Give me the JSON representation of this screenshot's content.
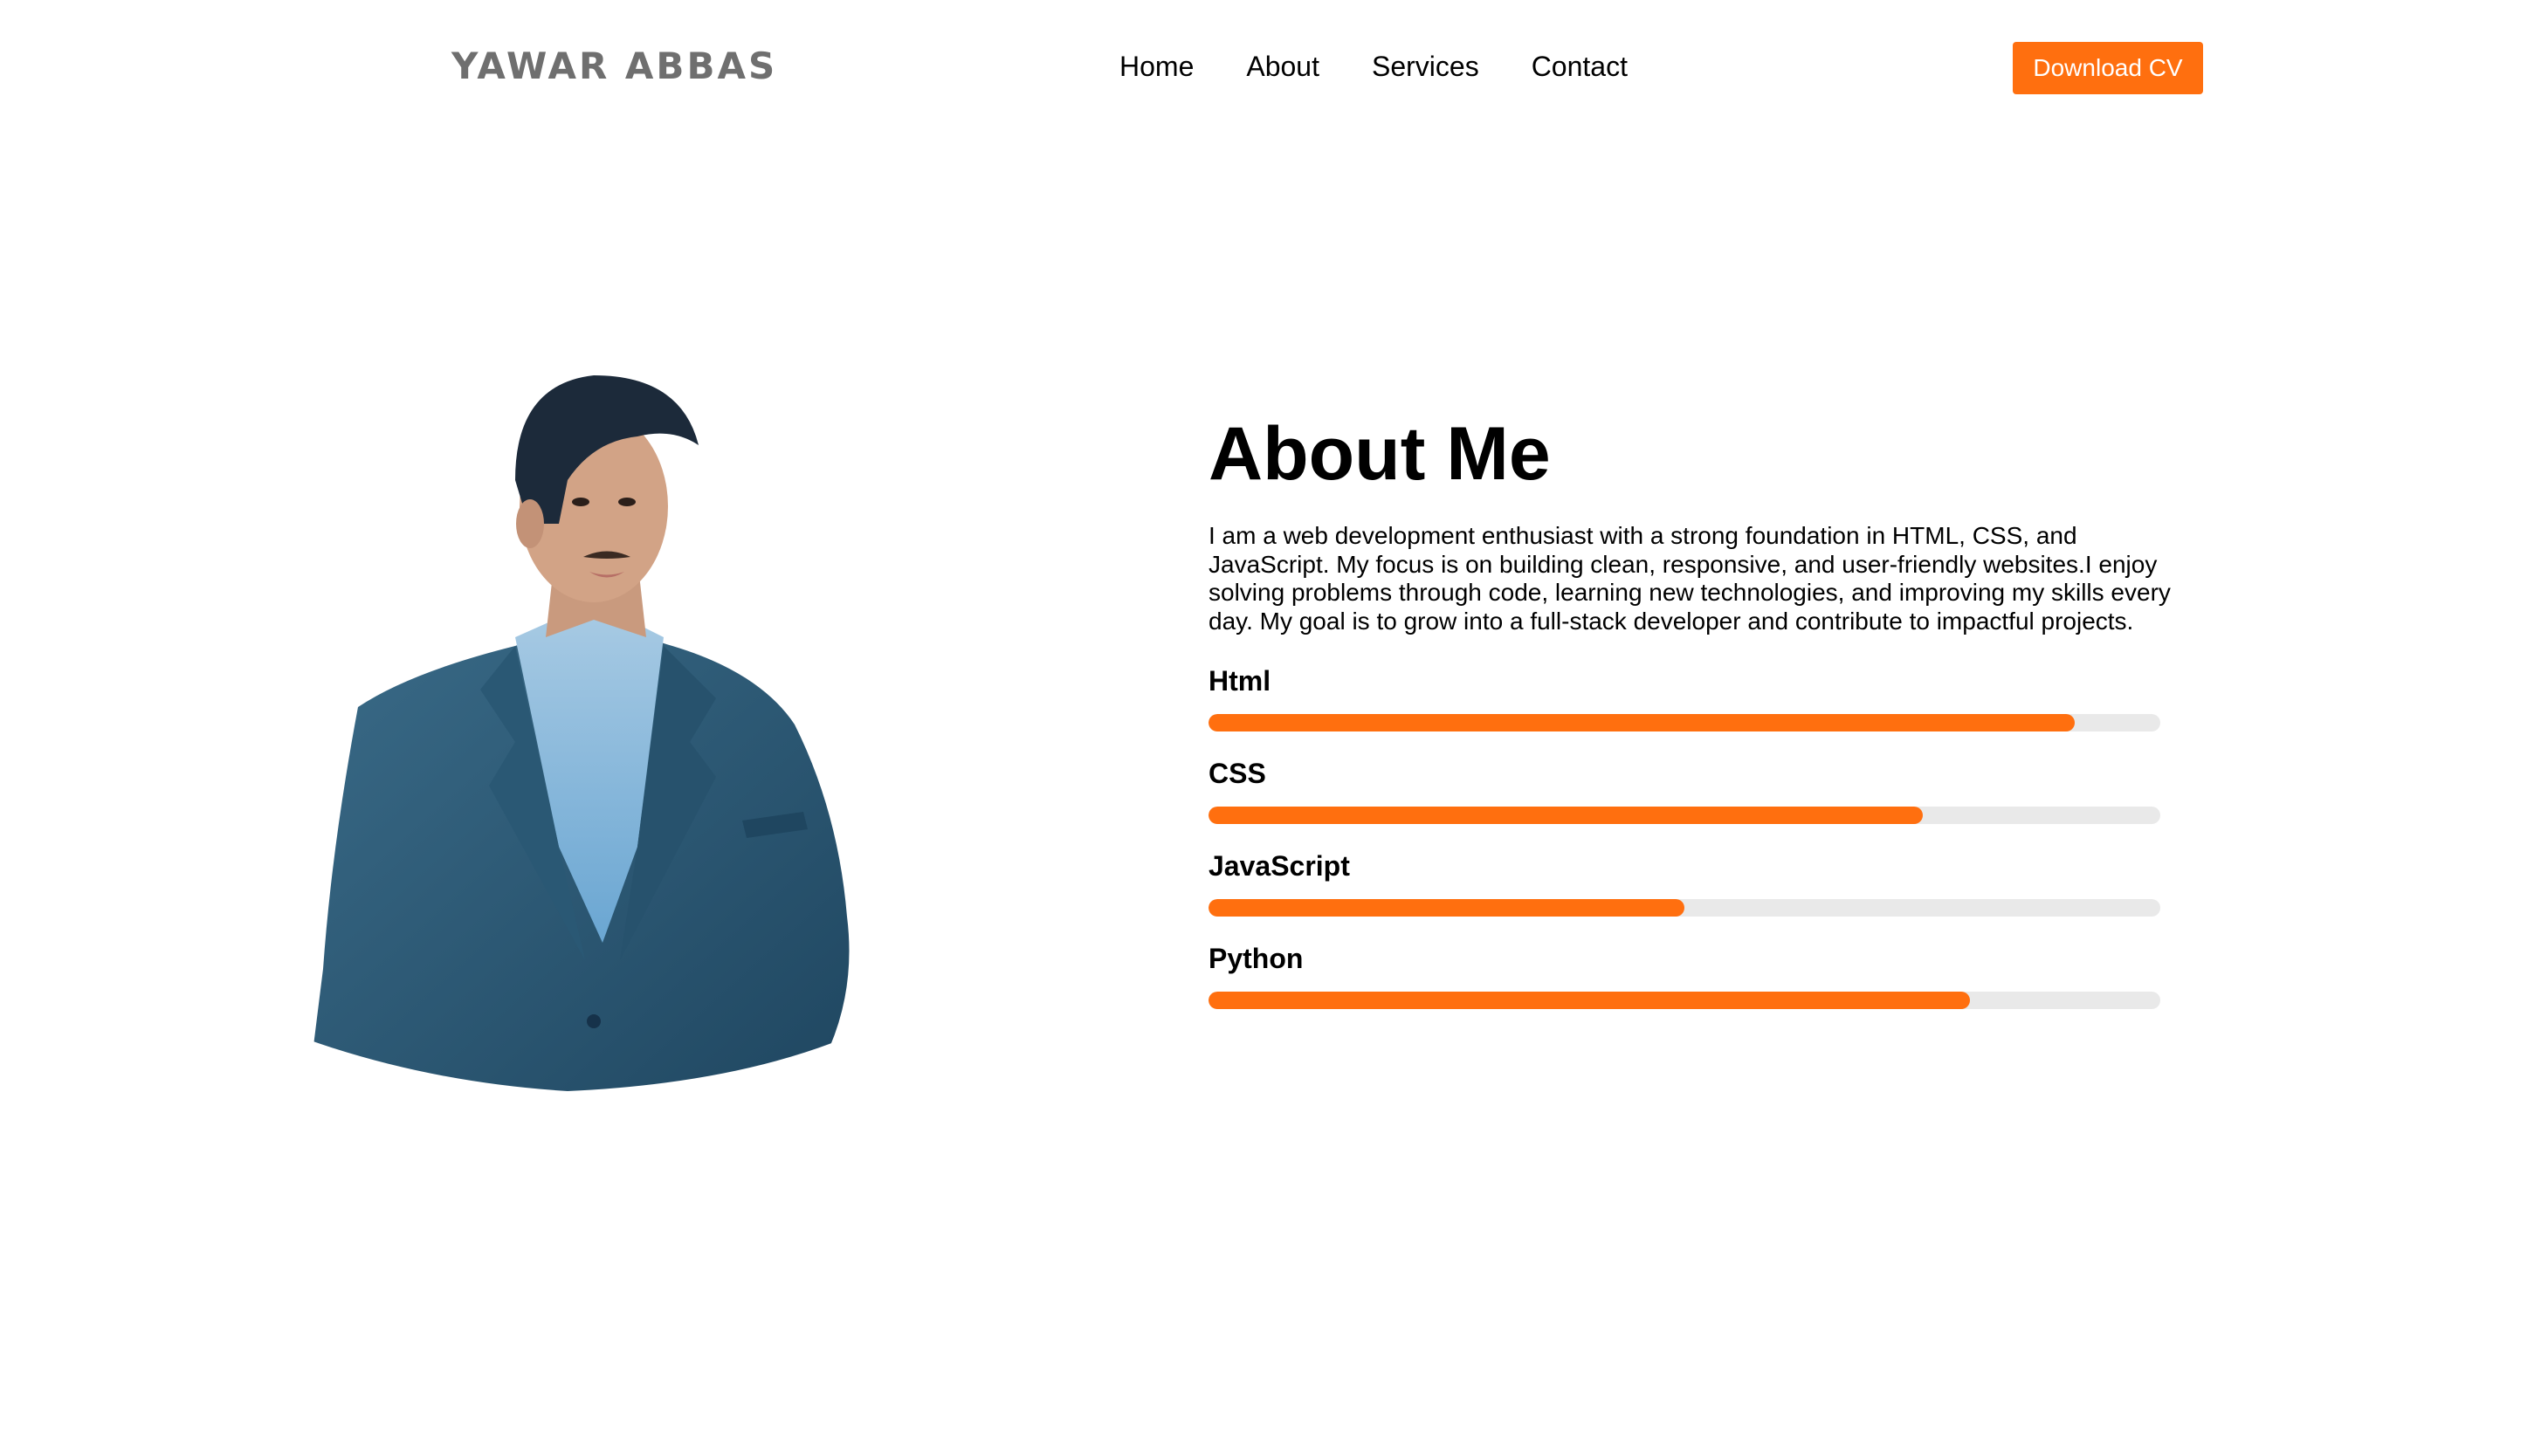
{
  "brand": {
    "name": "YAWAR ABBAS",
    "text_color": "#6f6f6f"
  },
  "nav": {
    "items": [
      {
        "label": "Home"
      },
      {
        "label": "About"
      },
      {
        "label": "Services"
      },
      {
        "label": "Contact"
      }
    ],
    "cta_label": "Download CV"
  },
  "about": {
    "title": "About Me",
    "paragraph": "I am a web development enthusiast with a strong foundation in HTML, CSS, and JavaScript. My focus is on building clean, responsive, and user-friendly websites.I enjoy solving problems through code, learning new technologies, and improving my skills every day. My goal is to grow into a full-stack developer and contribute to impactful projects."
  },
  "skills": [
    {
      "name": "Html",
      "level": 0.91
    },
    {
      "name": "CSS",
      "level": 0.75
    },
    {
      "name": "JavaScript",
      "level": 0.5
    },
    {
      "name": "Python",
      "level": 0.8
    }
  ],
  "colors": {
    "accent": "#ff6f0f",
    "track": "#e9e9e9",
    "suit": "#2b5672",
    "shirt": "#7fb6db"
  }
}
